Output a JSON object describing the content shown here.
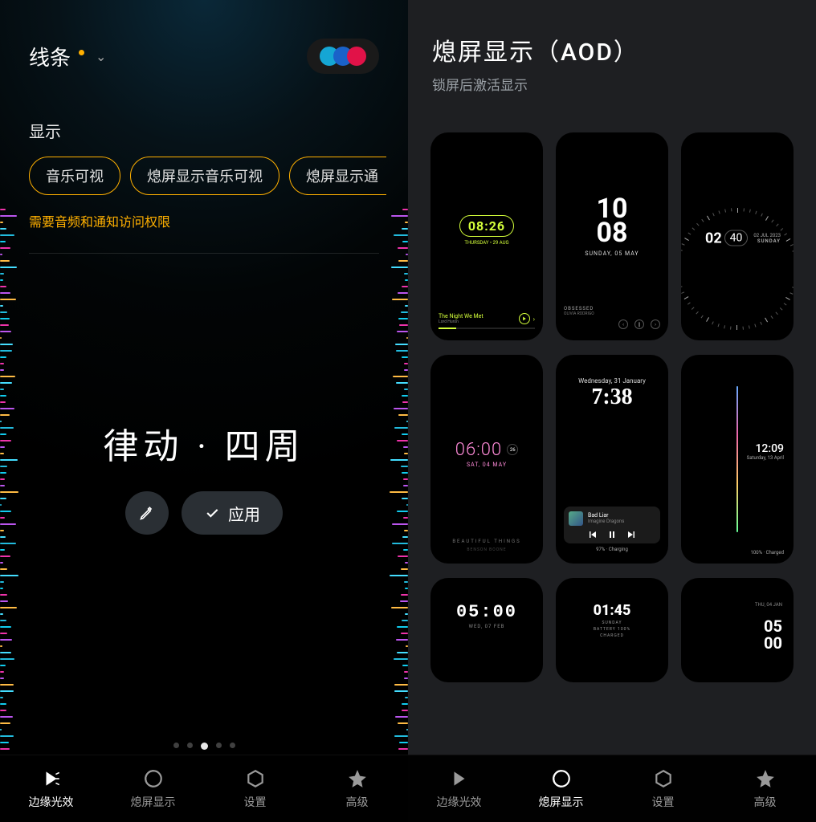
{
  "left": {
    "dropdown": "线条",
    "color_dots": [
      "#15a6d4",
      "#1a62c9",
      "#e11248"
    ],
    "section_title": "显示",
    "chips": [
      "音乐可视",
      "熄屏显示音乐可视",
      "熄屏显示通"
    ],
    "warning": "需要音频和通知访问权限",
    "preview_name": "律动 · 四周",
    "apply_btn": "应用",
    "page_index": 2,
    "page_count": 5
  },
  "right": {
    "title": "熄屏显示（AOD）",
    "subtitle": "锁屏后激活显示",
    "cards": [
      {
        "id": "c1",
        "time": "08:26",
        "date": "THURSDAY • 29 AUG",
        "song": "The Night We Met",
        "artist": "Lord Huron"
      },
      {
        "id": "c2",
        "time_top": "10",
        "time_bot": "08",
        "date": "SUNDAY, 05 MAY",
        "song": "OBSESSED",
        "artist": "OLIVIA RODRIGO"
      },
      {
        "id": "c3",
        "hour": "02",
        "minute": "40",
        "date": "02 JUL 2023",
        "weekday": "SUNDAY"
      },
      {
        "id": "c4",
        "time": "06:00",
        "date": "SAT, 04 MAY",
        "badge": "26",
        "footer_title": "BEAUTIFUL THINGS",
        "footer_artist": "BENSON BOONE"
      },
      {
        "id": "c5",
        "date": "Wednesday, 31 January",
        "time": "7:38",
        "song": "Bad Liar",
        "artist": "Imagine Dragons",
        "charge": "97% · Charging"
      },
      {
        "id": "c6",
        "time": "12:09",
        "date": "Saturday, 13 April",
        "charge": "100% · Charged"
      },
      {
        "id": "c7",
        "time": "05:00",
        "date": "WED, 07 FEB"
      },
      {
        "id": "c8",
        "time": "01:45",
        "weekday": "SUNDAY",
        "battery": "BATTERY 100%",
        "status": "CHARGED"
      },
      {
        "id": "c9",
        "date": "THU, 04 JAN",
        "time_top": "05",
        "time_bot": "00"
      }
    ]
  },
  "nav": {
    "items": [
      {
        "label": "边缘光效"
      },
      {
        "label": "熄屏显示"
      },
      {
        "label": "设置"
      },
      {
        "label": "高级"
      }
    ],
    "active_left": 0,
    "active_right": 1
  }
}
